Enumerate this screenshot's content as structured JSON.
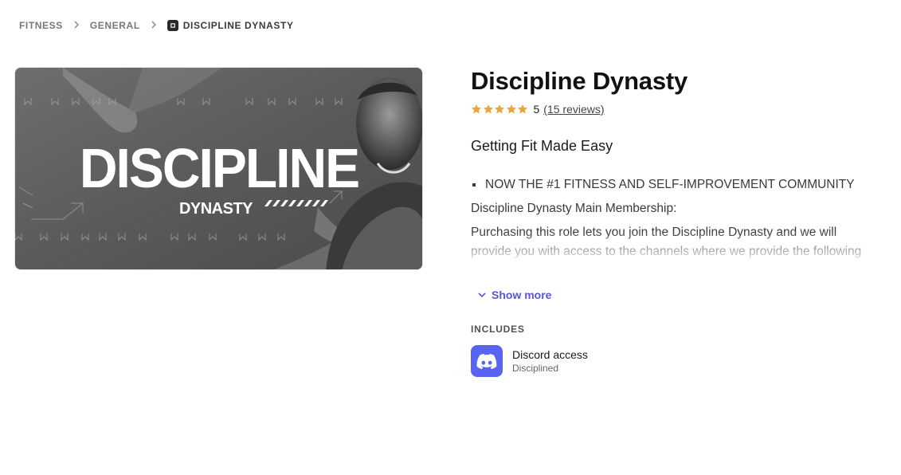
{
  "breadcrumb": {
    "items": [
      "FITNESS",
      "GENERAL"
    ],
    "current": "DISCIPLINE DYNASTY",
    "separator": ">"
  },
  "hero": {
    "title_text": "DISCIPLINE",
    "subtitle_text": "DYNASTY"
  },
  "product": {
    "title": "Discipline Dynasty",
    "rating_value": "5",
    "reviews_label": "(15 reviews)",
    "star_count": 5,
    "star_color": "#e8a93c",
    "tagline": "Getting Fit Made Easy"
  },
  "description": {
    "bullet": "NOW THE #1 FITNESS AND SELF-IMPROVEMENT COMMUNITY",
    "line1": "Discipline Dynasty Main Membership:",
    "line2": "Purchasing this role lets you join the Discipline Dynasty and we will provide you with access to the channels where we provide the following"
  },
  "show_more": "Show more",
  "includes": {
    "label": "INCLUDES",
    "items": [
      {
        "name": "Discord access",
        "sub": "Disciplined",
        "icon": "discord-icon",
        "color": "#5865f2"
      }
    ]
  },
  "colors": {
    "accent": "#5b54d6",
    "muted": "#77777d"
  }
}
